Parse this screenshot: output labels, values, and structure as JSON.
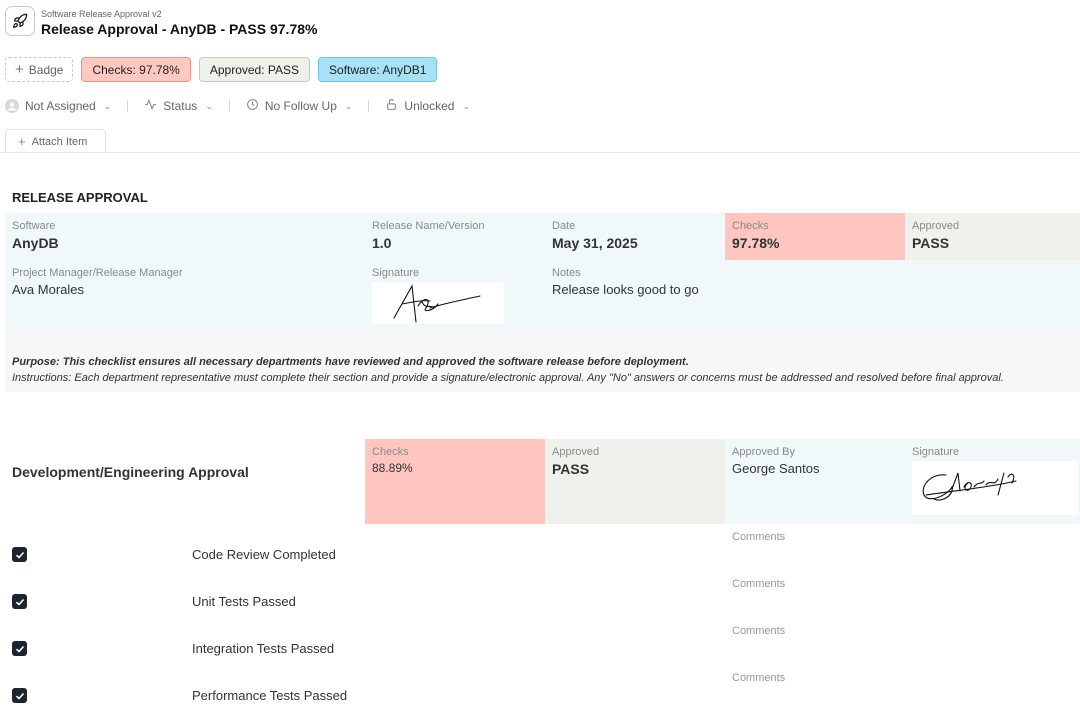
{
  "header": {
    "template_name": "Software Release Approval v2",
    "title": "Release Approval - AnyDB - PASS 97.78%"
  },
  "badges": {
    "add_label": "Badge",
    "items": [
      {
        "label": "Checks: 97.78%",
        "color": "#ffc8c0"
      },
      {
        "label": "Approved: PASS",
        "color": "#edf1ea"
      },
      {
        "label": "Software: AnyDB1",
        "color": "#a8e0f5"
      }
    ]
  },
  "properties": {
    "assignee": "Not Assigned",
    "status": "Status",
    "follow_up": "No Follow Up",
    "lock": "Unlocked"
  },
  "attach_label": "Attach Item",
  "release": {
    "section_title": "RELEASE APPROVAL",
    "software_label": "Software",
    "software": "AnyDB",
    "version_label": "Release Name/Version",
    "version": "1.0",
    "date_label": "Date",
    "date": "May 31, 2025",
    "checks_label": "Checks",
    "checks": "97.78%",
    "approved_label": "Approved",
    "approved": "PASS",
    "manager_label": "Project Manager/Release Manager",
    "manager": "Ava Morales",
    "signature_label": "Signature",
    "notes_label": "Notes",
    "notes": "Release looks good to go"
  },
  "purpose": {
    "purpose_text": "Purpose: This checklist ensures all necessary departments have reviewed and approved the software release before deployment.",
    "instructions_text": "Instructions: Each department representative must complete their section and provide a signature/electronic approval. Any \"No\" answers or concerns must be addressed and resolved before final approval."
  },
  "dev": {
    "title": "Development/Engineering Approval",
    "checks_label": "Checks",
    "checks": "88.89%",
    "approved_label": "Approved",
    "approved": "PASS",
    "approved_by_label": "Approved By",
    "approved_by": "George Santos",
    "signature_label": "Signature",
    "items": [
      {
        "label": "Code Review Completed",
        "checked": true,
        "comments_placeholder": "Comments"
      },
      {
        "label": "Unit Tests Passed",
        "checked": true,
        "comments_placeholder": "Comments"
      },
      {
        "label": "Integration Tests Passed",
        "checked": true,
        "comments_placeholder": "Comments"
      },
      {
        "label": "Performance Tests Passed",
        "checked": true,
        "comments_placeholder": "Comments"
      }
    ]
  },
  "colors": {
    "checks_bg": "#ffc6bf",
    "approved_bg": "#eef1ec",
    "info_bg": "#f0f8fa",
    "checkbox": "#1c2430"
  }
}
